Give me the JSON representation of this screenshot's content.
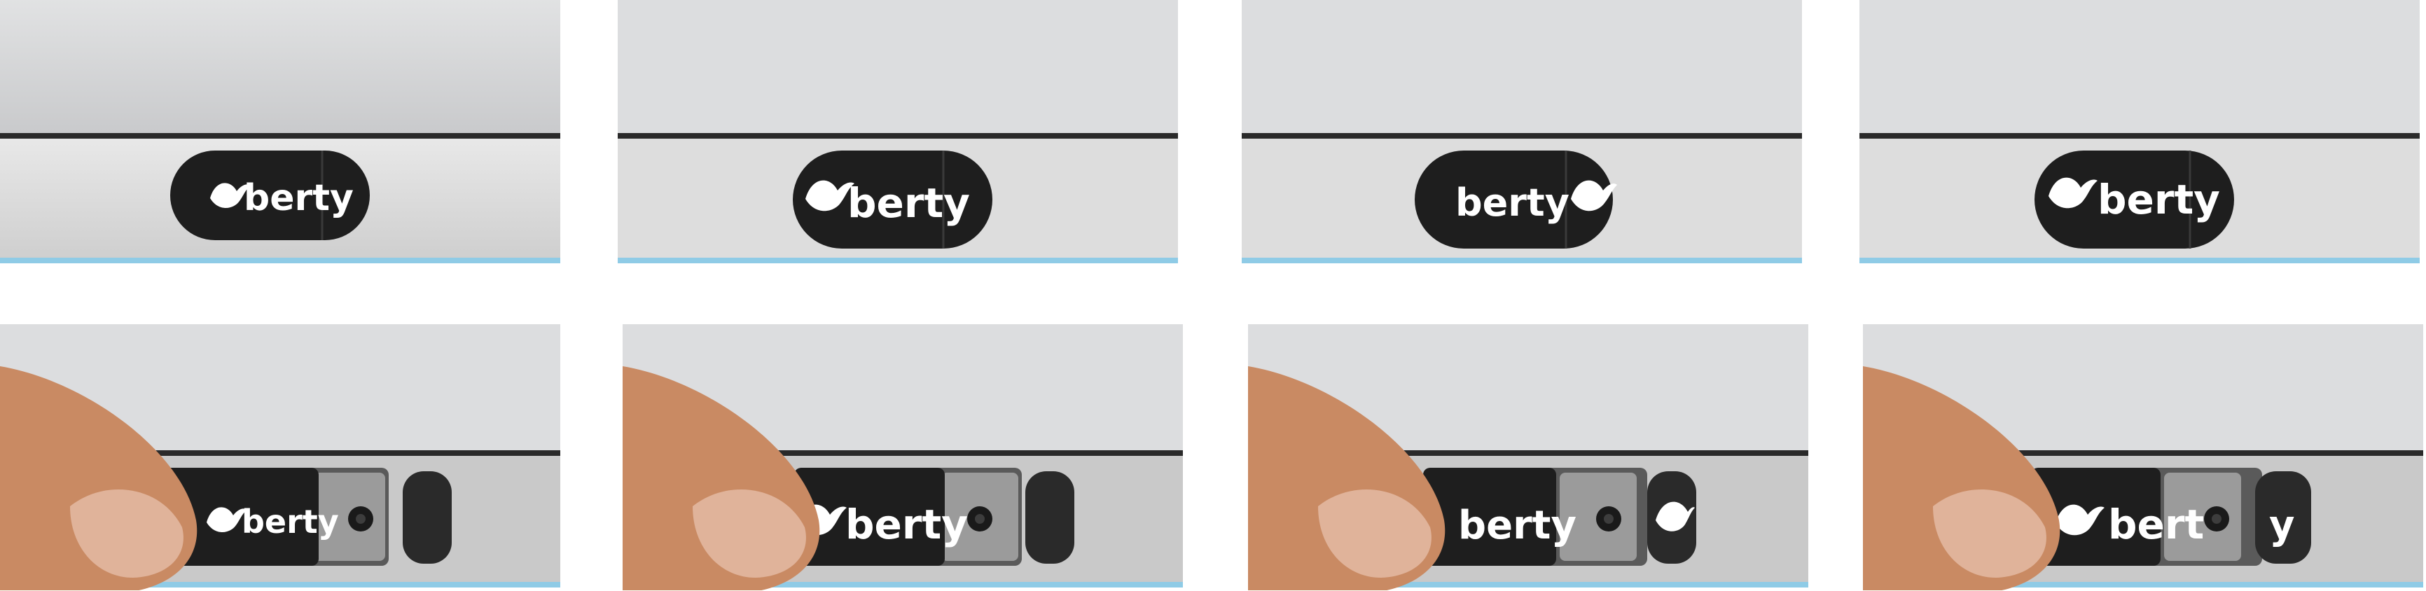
{
  "brand": {
    "word": "berty",
    "partial_word": "bert",
    "end_letter": "y"
  },
  "colors": {
    "cover": "#1e1e1e",
    "bezel_light": "#e6e6e6",
    "bezel_dark": "#c9c9c9",
    "screen_top": "#c8c9cb",
    "screen_bottom": "#e9eaeb",
    "accent_strip": "#8fcbe6",
    "skin": "#c98a63"
  },
  "tiles": [
    {
      "state": "closed",
      "logo_side": "left"
    },
    {
      "state": "closed",
      "logo_side": "left"
    },
    {
      "state": "closed",
      "logo_side": "right"
    },
    {
      "state": "closed",
      "logo_side": "left"
    },
    {
      "state": "open",
      "logo_side": "left"
    },
    {
      "state": "open",
      "logo_side": "left"
    },
    {
      "state": "open",
      "logo_side": "right"
    },
    {
      "state": "open",
      "logo_side": "split"
    }
  ]
}
